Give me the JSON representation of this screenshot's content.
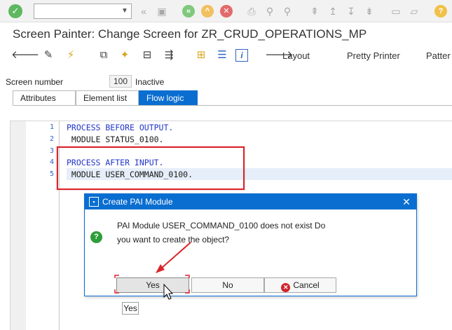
{
  "toolbar": {
    "command_field": {
      "value": "",
      "placeholder": ""
    },
    "icons": [
      "ok-icon",
      "dropdown-icon",
      "back-icon",
      "save-icon",
      "back-green-icon",
      "exit-icon",
      "cancel-icon",
      "print-icon",
      "find-icon",
      "find-next-icon",
      "first-page-icon",
      "prev-page-icon",
      "next-page-icon",
      "last-page-icon",
      "create-session-icon",
      "shortcut-icon",
      "help-icon"
    ]
  },
  "title": "Screen Painter: Change Screen for ZR_CRUD_OPERATIONS_MP",
  "app_toolbar": {
    "icons": [
      "back-arrow-icon",
      "display-change-icon",
      "activate-icon",
      "where-used-icon",
      "magic-wand-icon",
      "display-object-list-icon",
      "navigation-icon",
      "hierarchy-icon",
      "tree-icon",
      "info-icon"
    ],
    "layout_label": "Layout",
    "pretty_printer_label": "Pretty Printer",
    "pattern_label": "Patter"
  },
  "screen": {
    "number_label": "Screen number",
    "number_value": "100",
    "status": "Inactive"
  },
  "tabs": [
    {
      "label": "Attributes",
      "active": false
    },
    {
      "label": "Element list",
      "active": false
    },
    {
      "label": "Flow logic",
      "active": true
    }
  ],
  "editor": {
    "lines": [
      {
        "num": "1",
        "text": "PROCESS BEFORE OUTPUT."
      },
      {
        "num": "2",
        "text": " MODULE STATUS_0100."
      },
      {
        "num": "3",
        "text": ""
      },
      {
        "num": "4",
        "text": "PROCESS AFTER INPUT."
      },
      {
        "num": "5",
        "text": " MODULE USER_COMMAND_0100."
      }
    ]
  },
  "dialog": {
    "title": "Create PAI Module",
    "message_line1": "PAI Module USER_COMMAND_0100 does not exist Do",
    "message_line2": "you want to create the object?",
    "buttons": {
      "yes": "Yes",
      "no": "No",
      "cancel": "Cancel"
    }
  },
  "tooltip": "Yes",
  "colors": {
    "accent": "#0a6ed1",
    "annotation": "#d9262b",
    "keyword": "#2136c9",
    "line_number": "#2f63c5"
  }
}
